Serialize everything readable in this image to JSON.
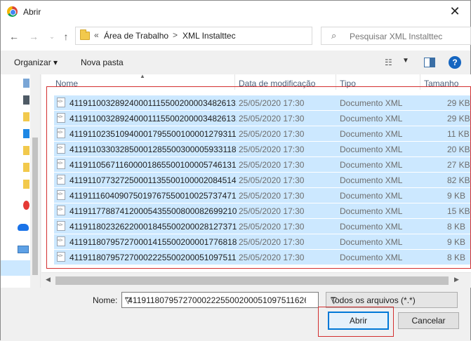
{
  "window": {
    "title": "Abrir"
  },
  "address": {
    "overflow": "«",
    "crumbs": [
      "Área de Trabalho",
      "XML Instalttec"
    ],
    "separator": ">"
  },
  "search": {
    "placeholder": "Pesquisar XML Instalttec"
  },
  "toolbar": {
    "organize_label": "Organizar ▾",
    "new_folder_label": "Nova pasta"
  },
  "columns": {
    "name": "Nome",
    "date": "Data de modificação",
    "type": "Tipo",
    "size": "Tamanho"
  },
  "files": [
    {
      "name": "41191100328924000111550020000348261314112145",
      "date": "25/05/2020 17:30",
      "type": "Documento XML",
      "size": "29 KB"
    },
    {
      "name": "41191100328924000111550020000348261314112146",
      "date": "25/05/2020 17:30",
      "type": "Documento XML",
      "size": "29 KB"
    },
    {
      "name": "41191102351094000179550010000127931161626634",
      "date": "25/05/2020 17:30",
      "type": "Documento XML",
      "size": "11 KB"
    },
    {
      "name": "41191103303285000128550030000593311861626634",
      "date": "25/05/2020 17:30",
      "type": "Documento XML",
      "size": "20 KB"
    },
    {
      "name": "41191105671160000186550010000574613161626634",
      "date": "25/05/2020 17:30",
      "type": "Documento XML",
      "size": "27 KB"
    },
    {
      "name": "41191107732725000113550010000208451461626634",
      "date": "25/05/2020 17:30",
      "type": "Documento XML",
      "size": "82 KB"
    },
    {
      "name": "41191116040907501976755001002573747121626634",
      "date": "25/05/2020 17:30",
      "type": "Documento XML",
      "size": "9 KB"
    },
    {
      "name": "41191177887412000543550080008269921061626634",
      "date": "25/05/2020 17:30",
      "type": "Documento XML",
      "size": "15 KB"
    },
    {
      "name": "41191180232622000184550020002812737161626634",
      "date": "25/05/2020 17:30",
      "type": "Documento XML",
      "size": "8 KB"
    },
    {
      "name": "41191180795727000141550020000177681861626634",
      "date": "25/05/2020 17:30",
      "type": "Documento XML",
      "size": "9 KB"
    },
    {
      "name": "41191180795727000222550020005109751161626634",
      "date": "25/05/2020 17:30",
      "type": "Documento XML",
      "size": "8 KB"
    }
  ],
  "footer": {
    "name_label": "Nome:",
    "name_value": "\"41191180795727000222550020005109751162663 4",
    "filetype_value": "Todos os arquivos (*.*)",
    "open_label": "Abrir",
    "cancel_label": "Cancelar"
  },
  "colors": {
    "selection": "#cce8ff",
    "accent": "#0078d7",
    "highlight_frame": "#d32f2f"
  },
  "icons": [
    "chrome-icon",
    "back-arrow-icon",
    "forward-arrow-icon",
    "recent-dropdown-icon",
    "up-arrow-icon",
    "folder-icon",
    "refresh-icon",
    "search-icon",
    "view-options-icon",
    "preview-pane-icon",
    "help-icon",
    "xml-file-icon"
  ]
}
